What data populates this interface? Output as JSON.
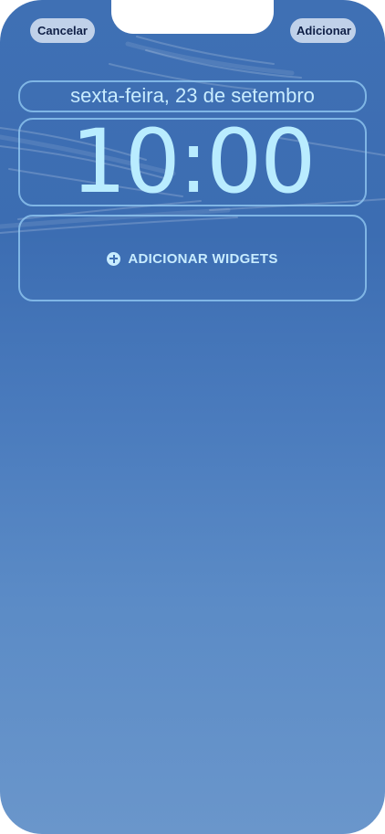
{
  "header": {
    "cancel_label": "Cancelar",
    "add_label": "Adicionar"
  },
  "lock_screen": {
    "date": "sexta-feira, 23 de setembro",
    "time": "10:00",
    "add_widgets_label": "ADICIONAR WIDGETS",
    "add_widgets_icon": "plus-circle-icon"
  },
  "colors": {
    "accent_text": "#c8ecff",
    "wallpaper_top": "#3f70b4",
    "wallpaper_bottom": "#6a96cb"
  }
}
